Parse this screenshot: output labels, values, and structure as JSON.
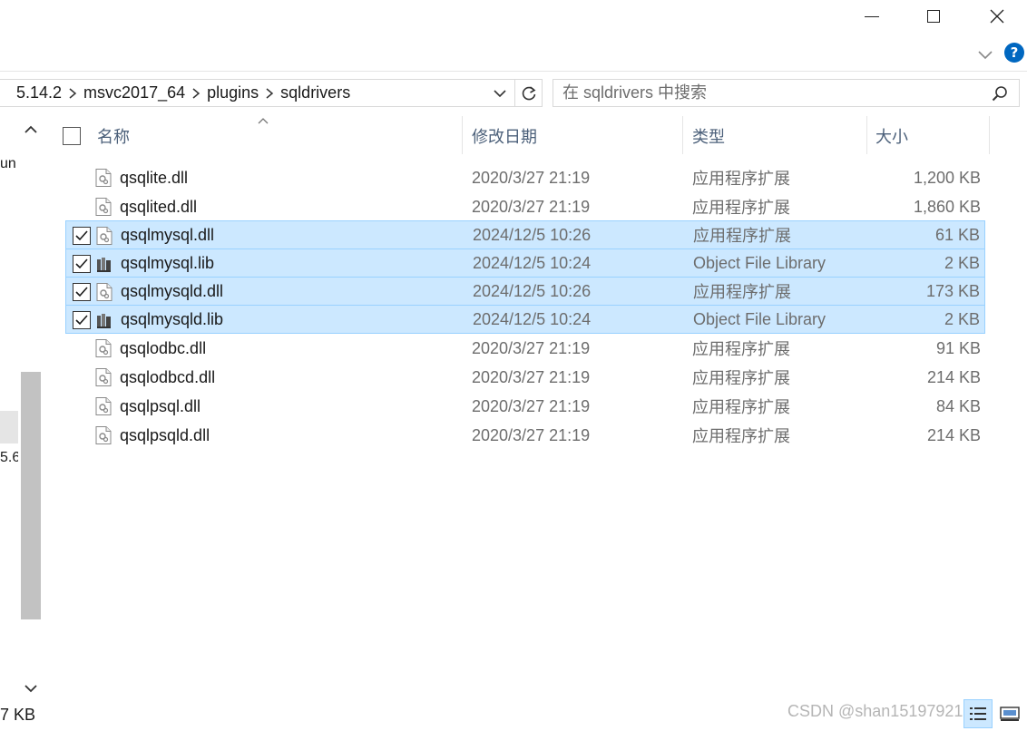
{
  "window": {
    "controls": [
      "minimize",
      "maximize",
      "close"
    ],
    "help_label": "?"
  },
  "address_bar": {
    "breadcrumbs": [
      "5.14.2",
      "msvc2017_64",
      "plugins",
      "sqldrivers"
    ]
  },
  "search": {
    "placeholder": "在 sqldrivers 中搜索"
  },
  "nav_pane": {
    "fragment_1": "un",
    "fragment_2": "5.6."
  },
  "columns": {
    "name": "名称",
    "date": "修改日期",
    "type": "类型",
    "size": "大小"
  },
  "files": [
    {
      "name": "qsqlite.dll",
      "date": "2020/3/27 21:19",
      "type": "应用程序扩展",
      "size": "1,200 KB",
      "selected": false,
      "icon": "dll-icon"
    },
    {
      "name": "qsqlited.dll",
      "date": "2020/3/27 21:19",
      "type": "应用程序扩展",
      "size": "1,860 KB",
      "selected": false,
      "icon": "dll-icon"
    },
    {
      "name": "qsqlmysql.dll",
      "date": "2024/12/5 10:26",
      "type": "应用程序扩展",
      "size": "61 KB",
      "selected": true,
      "icon": "dll-icon"
    },
    {
      "name": "qsqlmysql.lib",
      "date": "2024/12/5 10:24",
      "type": "Object File Library",
      "size": "2 KB",
      "selected": true,
      "icon": "lib-icon"
    },
    {
      "name": "qsqlmysqld.dll",
      "date": "2024/12/5 10:26",
      "type": "应用程序扩展",
      "size": "173 KB",
      "selected": true,
      "icon": "dll-icon"
    },
    {
      "name": "qsqlmysqld.lib",
      "date": "2024/12/5 10:24",
      "type": "Object File Library",
      "size": "2 KB",
      "selected": true,
      "icon": "lib-icon"
    },
    {
      "name": "qsqlodbc.dll",
      "date": "2020/3/27 21:19",
      "type": "应用程序扩展",
      "size": "91 KB",
      "selected": false,
      "icon": "dll-icon"
    },
    {
      "name": "qsqlodbcd.dll",
      "date": "2020/3/27 21:19",
      "type": "应用程序扩展",
      "size": "214 KB",
      "selected": false,
      "icon": "dll-icon"
    },
    {
      "name": "qsqlpsql.dll",
      "date": "2020/3/27 21:19",
      "type": "应用程序扩展",
      "size": "84 KB",
      "selected": false,
      "icon": "dll-icon"
    },
    {
      "name": "qsqlpsqld.dll",
      "date": "2020/3/27 21:19",
      "type": "应用程序扩展",
      "size": "214 KB",
      "selected": false,
      "icon": "dll-icon"
    }
  ],
  "status_bar": {
    "size_text": "7 KB"
  },
  "watermark": "CSDN @shan15197921650",
  "colors": {
    "selection_bg": "#cce8ff",
    "selection_border": "#99d1ff",
    "header_text": "#4c607a",
    "help_blue": "#0067c0"
  }
}
